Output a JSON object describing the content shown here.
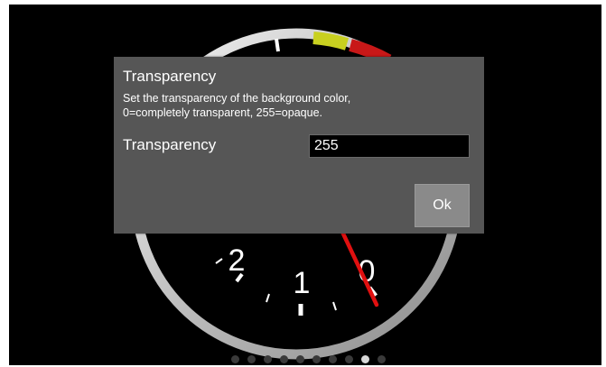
{
  "dialog": {
    "title": "Transparency",
    "description_line1": "Set the transparency of the background color,",
    "description_line2": "0=completely transparent, 255=opaque.",
    "field_label": "Transparency",
    "field_value": "255",
    "ok_label": "Ok"
  },
  "gauge": {
    "scale_labels": [
      "2",
      "1",
      "0"
    ],
    "needle_color": "#e01010",
    "zone_colors": {
      "caution": "#c8d020",
      "danger": "#c81818"
    }
  },
  "pager": {
    "total_pages": 10,
    "active_index": 8
  },
  "colors": {
    "background": "#000000",
    "dialog_background": "#565656",
    "button_background": "#8a8a8a"
  }
}
